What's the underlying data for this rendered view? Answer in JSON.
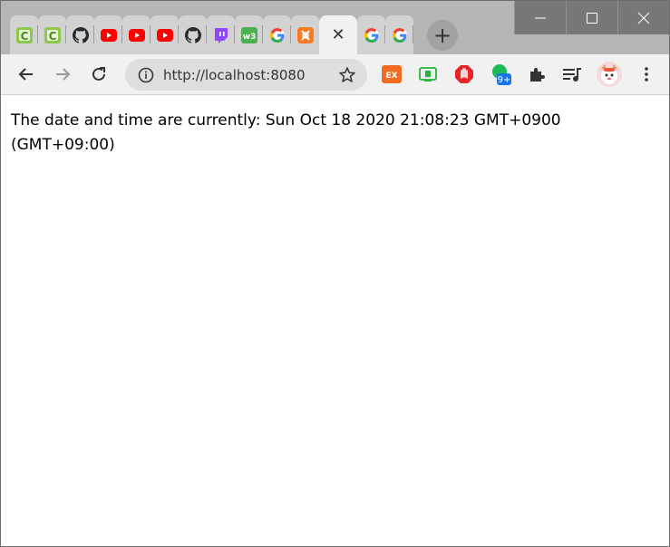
{
  "browser": {
    "tabs": [
      {
        "favicon": "c-green-icon"
      },
      {
        "favicon": "c-green-icon"
      },
      {
        "favicon": "github-icon"
      },
      {
        "favicon": "youtube-icon"
      },
      {
        "favicon": "youtube-icon"
      },
      {
        "favicon": "youtube-icon"
      },
      {
        "favicon": "github-icon"
      },
      {
        "favicon": "twitch-icon"
      },
      {
        "favicon": "w3-icon"
      },
      {
        "favicon": "google-icon"
      },
      {
        "favicon": "xampp-icon"
      },
      {
        "favicon": "close-icon",
        "active": true
      },
      {
        "favicon": "google-icon"
      },
      {
        "favicon": "google-icon"
      }
    ],
    "new_tab_label": "+",
    "address": {
      "url": "http://localhost:8080"
    },
    "extensions": [
      {
        "name": "ex-extension-icon",
        "label": "EX"
      },
      {
        "name": "green-extension-icon",
        "label": ""
      },
      {
        "name": "stop-hand-extension-icon",
        "label": ""
      },
      {
        "name": "green-dot-extension-icon",
        "badge": "9+"
      },
      {
        "name": "puzzle-extensions-icon"
      },
      {
        "name": "media-queue-icon"
      },
      {
        "name": "profile-avatar"
      }
    ],
    "colors": {
      "titlebar": "#b5b5b5",
      "toolbar": "#f1f1f1",
      "window_controls": "#787878",
      "badge": "#1a73e8"
    }
  },
  "page": {
    "text": "The date and time are currently: Sun Oct 18 2020 21:08:23 GMT+0900 (GMT+09:00)"
  }
}
